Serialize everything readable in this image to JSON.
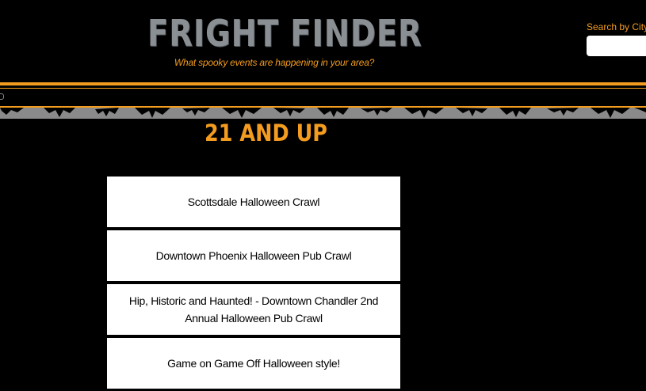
{
  "header": {
    "site_title": "FRIGHT FINDER",
    "tagline": "What spooky events are happening in your area?",
    "search_label": "Search by City!",
    "search_value": ""
  },
  "colors": {
    "background": "#000000",
    "accent": "#f39c1f",
    "title_gray": "#8a8f94",
    "card_background": "#ffffff"
  },
  "nav": {
    "toggle_icon": "menu-toggle-icon"
  },
  "banner": {
    "icon": "bat-silhouette-icon"
  },
  "main": {
    "section_heading": "21 AND UP",
    "events": [
      {
        "title": "Scottsdale Halloween Crawl"
      },
      {
        "title": "Downtown Phoenix Halloween Pub Crawl"
      },
      {
        "title": "Hip, Historic and Haunted! - Downtown Chandler 2nd Annual Halloween Pub Crawl"
      },
      {
        "title": "Game on Game Off Halloween style!"
      }
    ]
  }
}
